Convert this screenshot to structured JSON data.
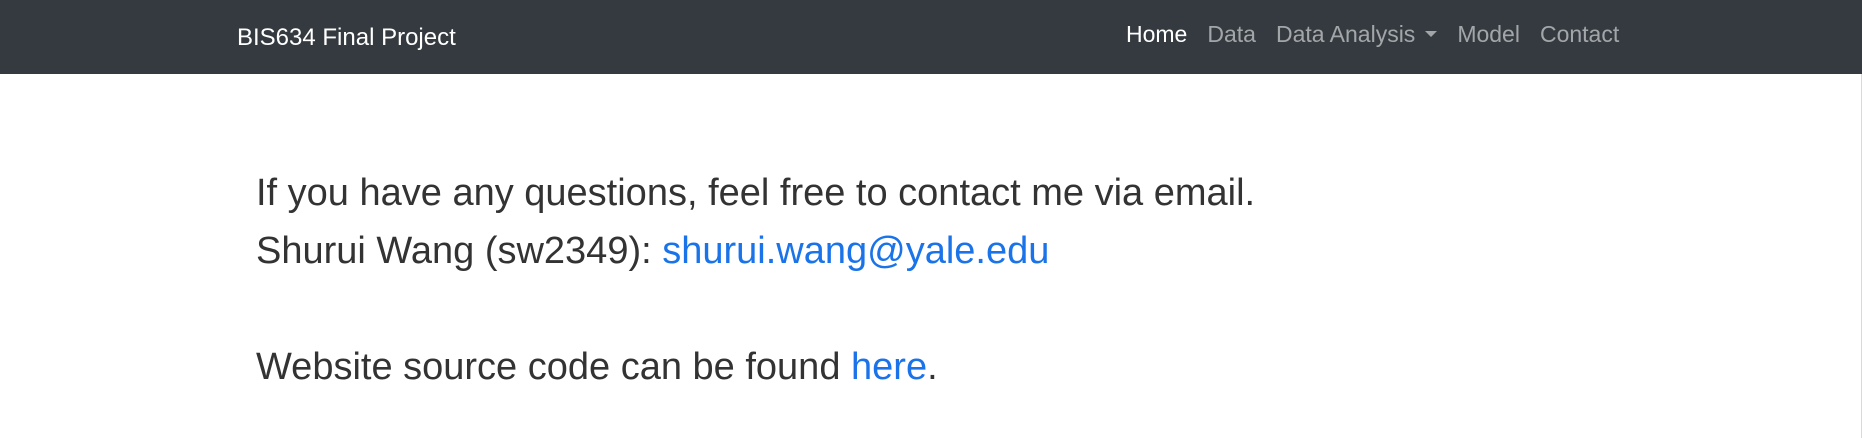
{
  "navbar": {
    "brand": "BIS634 Final Project",
    "items": [
      {
        "label": "Home",
        "active": true
      },
      {
        "label": "Data",
        "active": false
      },
      {
        "label": "Data Analysis",
        "active": false,
        "dropdown": true
      },
      {
        "label": "Model",
        "active": false
      },
      {
        "label": "Contact",
        "active": false
      }
    ]
  },
  "contact": {
    "intro": "If you have any questions, feel free to contact me via email.",
    "name_prefix": "Shurui Wang (sw2349): ",
    "email": "shurui.wang@yale.edu",
    "source_prefix": "Website source code can be found ",
    "source_link": "here",
    "source_suffix": "."
  },
  "colors": {
    "navbar_bg": "#343a40",
    "link": "#1a73e8",
    "text": "#333333"
  }
}
